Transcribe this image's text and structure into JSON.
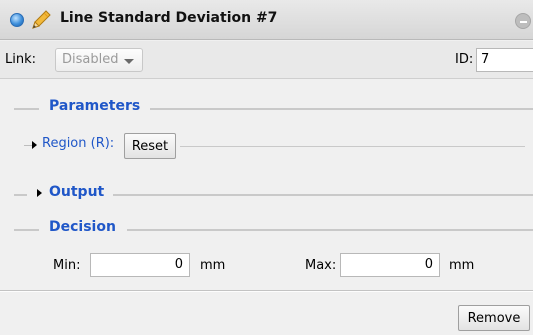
{
  "window": {
    "title": "Line Standard Deviation #7",
    "status_icon": "circle-blue-icon",
    "edit_icon": "pencil-icon",
    "collapse_icon": "minus-circle-icon"
  },
  "link_row": {
    "link_label": "Link:",
    "link_value": "Disabled",
    "id_label": "ID:",
    "id_value": "7"
  },
  "parameters": {
    "title": "Parameters",
    "region_label": "Region (R):",
    "reset_label": "Reset"
  },
  "output": {
    "title": "Output"
  },
  "decision": {
    "title": "Decision",
    "min_label": "Min:",
    "min_value": "0",
    "min_unit": "mm",
    "max_label": "Max:",
    "max_value": "0",
    "max_unit": "mm"
  },
  "footer": {
    "remove_label": "Remove"
  },
  "colors": {
    "section_title": "#2057c8",
    "status_dot": "#3e8fdb",
    "pencil": "#f2b93b"
  }
}
